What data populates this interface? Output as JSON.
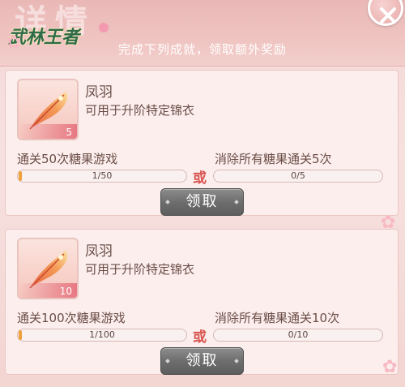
{
  "header": {
    "title": "详情",
    "logo_text": "武林王者",
    "subtitle": "完成下列成就，领取额外奖励",
    "close_label": "×"
  },
  "rewards": [
    {
      "name": "凤羽",
      "description": "可用于升阶特定锦衣",
      "count": "5",
      "task_a": {
        "label": "通关50次糖果游戏",
        "progress_text": "1/50",
        "fraction": 0.02
      },
      "task_b": {
        "label": "消除所有糖果通关5次",
        "progress_text": "0/5",
        "fraction": 0.0
      },
      "or_label": "或",
      "claim_label": "领取"
    },
    {
      "name": "凤羽",
      "description": "可用于升阶特定锦衣",
      "count": "10",
      "task_a": {
        "label": "通关100次糖果游戏",
        "progress_text": "1/100",
        "fraction": 0.01
      },
      "task_b": {
        "label": "消除所有糖果通关10次",
        "progress_text": "0/10",
        "fraction": 0.0
      },
      "or_label": "或",
      "claim_label": "领取"
    }
  ],
  "colors": {
    "accent_red": "#d9544f",
    "progress_fill": "#f0a13e",
    "button_gray": "#6e6e6e",
    "panel_bg": "#f3d9d6"
  },
  "icons": [
    "feather-icon",
    "close-icon",
    "flower-icon"
  ]
}
